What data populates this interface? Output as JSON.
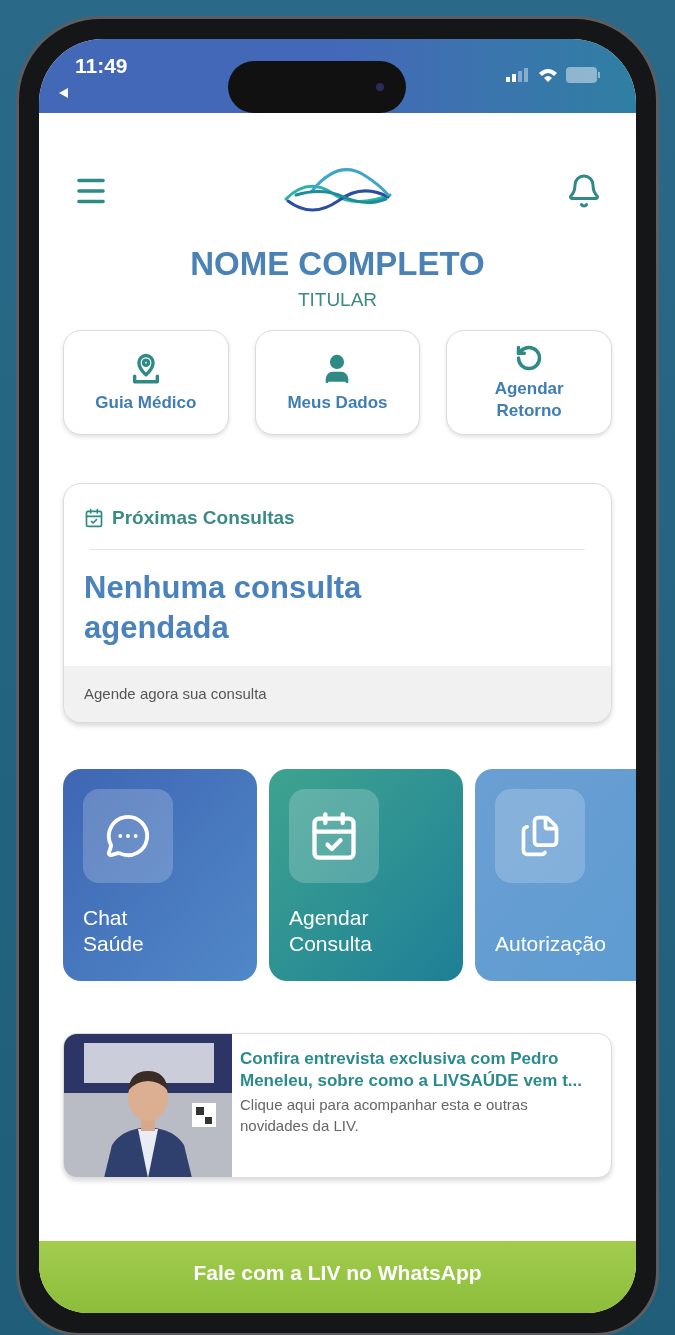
{
  "status_bar": {
    "time": "11:49"
  },
  "header": {
    "name": "NOME COMPLETO",
    "role": "TITULAR"
  },
  "shortcuts": [
    {
      "kind": "pin",
      "label": "Guia Médico"
    },
    {
      "kind": "person",
      "label": "Meus Dados"
    },
    {
      "kind": "refresh",
      "label": "Agendar Retorno"
    }
  ],
  "appointments": {
    "title": "Próximas Consultas",
    "message": "Nenhuma consulta agendada",
    "footer": "Agende agora sua consulta"
  },
  "tiles": [
    {
      "kind": "chat",
      "label": "Chat Saúde"
    },
    {
      "kind": "calendar",
      "label": "Agendar Consulta"
    },
    {
      "kind": "documents",
      "label": "Autorização"
    }
  ],
  "news": {
    "title": "Confira entrevista exclusiva com Pedro Meneleu, sobre como a LIVSAÚDE vem t...",
    "body": "Clique aqui para acompanhar esta e outras novidades da LIV."
  },
  "whatsapp_button": {
    "label": "Fale com a LIV no WhatsApp"
  }
}
